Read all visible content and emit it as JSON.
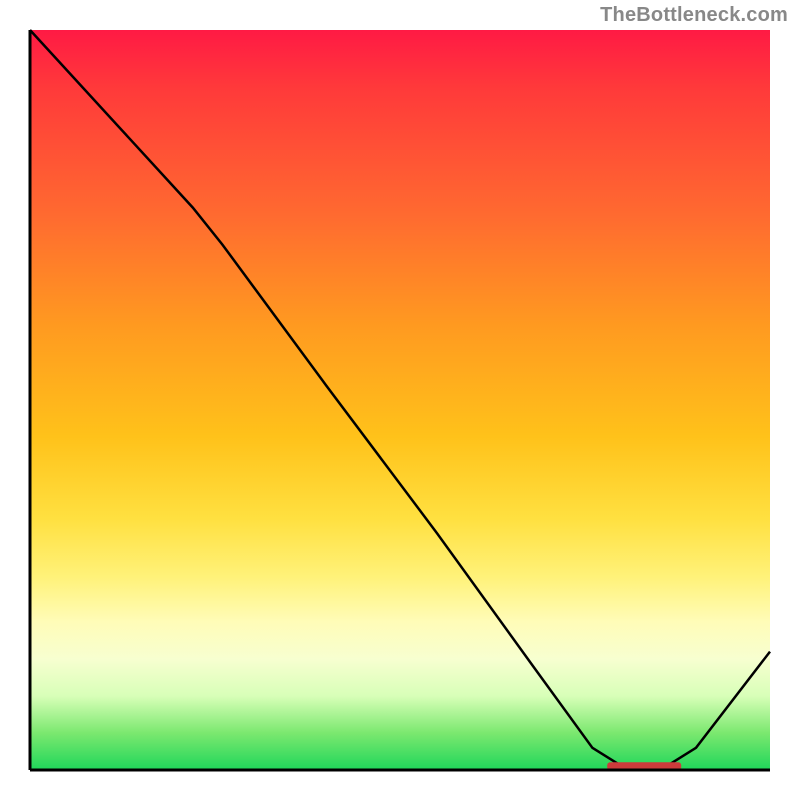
{
  "attribution": "TheBottleneck.com",
  "chart_data": {
    "type": "line",
    "title": "",
    "xlabel": "",
    "ylabel": "",
    "xlim": [
      0,
      100
    ],
    "ylim": [
      0,
      100
    ],
    "grid": false,
    "legend": false,
    "series": [
      {
        "name": "curve",
        "points": [
          {
            "x": 0,
            "y": 100
          },
          {
            "x": 22,
            "y": 76
          },
          {
            "x": 26,
            "y": 71
          },
          {
            "x": 40,
            "y": 52
          },
          {
            "x": 55,
            "y": 32
          },
          {
            "x": 68,
            "y": 14
          },
          {
            "x": 76,
            "y": 3
          },
          {
            "x": 80,
            "y": 0.5
          },
          {
            "x": 86,
            "y": 0.5
          },
          {
            "x": 90,
            "y": 3
          },
          {
            "x": 100,
            "y": 16
          }
        ]
      }
    ],
    "annotations": [
      {
        "name": "optimum-marker",
        "x_start": 78,
        "x_end": 88,
        "y": 0.5
      }
    ],
    "background_gradient_stops": [
      {
        "pos": 0.0,
        "color": "#ff1a44"
      },
      {
        "pos": 0.25,
        "color": "#ff6a30"
      },
      {
        "pos": 0.55,
        "color": "#ffc21a"
      },
      {
        "pos": 0.8,
        "color": "#fffcb8"
      },
      {
        "pos": 0.95,
        "color": "#7be86f"
      },
      {
        "pos": 1.0,
        "color": "#1fd65a"
      }
    ]
  }
}
